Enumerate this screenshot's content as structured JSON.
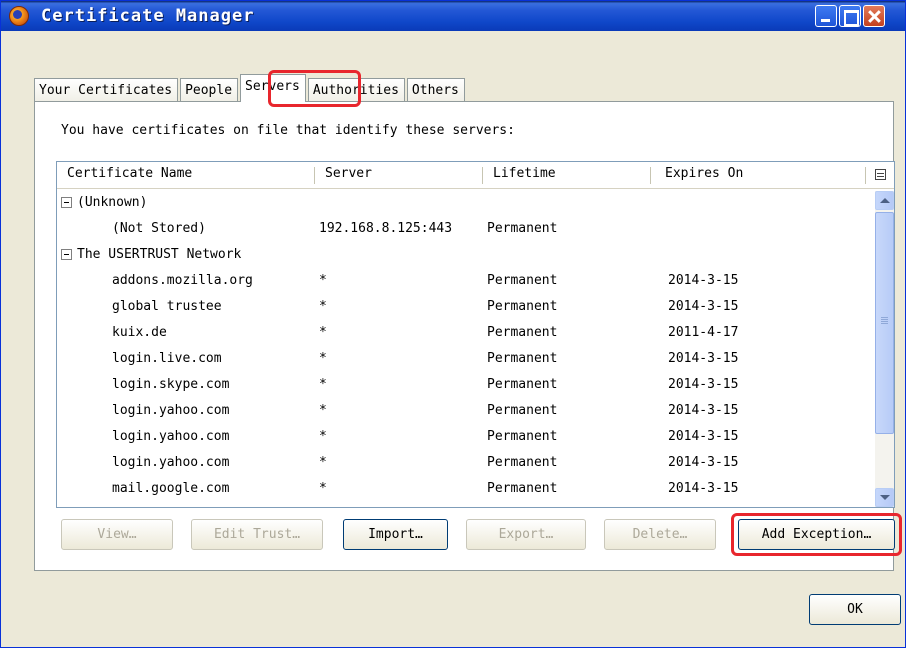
{
  "window": {
    "title": "Certificate Manager"
  },
  "tabs": [
    {
      "label": "Your Certificates"
    },
    {
      "label": "People"
    },
    {
      "label": "Servers"
    },
    {
      "label": "Authorities"
    },
    {
      "label": "Others"
    }
  ],
  "active_tab": "Servers",
  "intro_text": "You have certificates on file that identify these servers:",
  "columns": [
    "Certificate Name",
    "Server",
    "Lifetime",
    "Expires On"
  ],
  "tree": {
    "groups": [
      {
        "name": "(Unknown)",
        "rows": [
          {
            "name": "(Not Stored)",
            "server": "192.168.8.125:443",
            "lifetime": "Permanent",
            "expires": ""
          }
        ]
      },
      {
        "name": "The USERTRUST Network",
        "rows": [
          {
            "name": "addons.mozilla.org",
            "server": "*",
            "lifetime": "Permanent",
            "expires": "2014-3-15"
          },
          {
            "name": "global trustee",
            "server": "*",
            "lifetime": "Permanent",
            "expires": "2014-3-15"
          },
          {
            "name": "kuix.de",
            "server": "*",
            "lifetime": "Permanent",
            "expires": "2011-4-17"
          },
          {
            "name": "login.live.com",
            "server": "*",
            "lifetime": "Permanent",
            "expires": "2014-3-15"
          },
          {
            "name": "login.skype.com",
            "server": "*",
            "lifetime": "Permanent",
            "expires": "2014-3-15"
          },
          {
            "name": "login.yahoo.com",
            "server": "*",
            "lifetime": "Permanent",
            "expires": "2014-3-15"
          },
          {
            "name": "login.yahoo.com",
            "server": "*",
            "lifetime": "Permanent",
            "expires": "2014-3-15"
          },
          {
            "name": "login.yahoo.com",
            "server": "*",
            "lifetime": "Permanent",
            "expires": "2014-3-15"
          },
          {
            "name": "mail.google.com",
            "server": "*",
            "lifetime": "Permanent",
            "expires": "2014-3-15"
          }
        ]
      }
    ]
  },
  "buttons": {
    "view": "View…",
    "edit_trust": "Edit Trust…",
    "import": "Import…",
    "export": "Export…",
    "delete": "Delete…",
    "add_exception": "Add Exception…",
    "ok": "OK"
  },
  "icons": {
    "app": "firefox-icon",
    "minimize": "minimize-icon",
    "maximize": "maximize-icon",
    "close": "close-icon",
    "column_picker": "column-picker-icon"
  },
  "colors": {
    "highlight": "#e8262d",
    "titlebar": "#0f47c9",
    "dialog_bg": "#ece9d8"
  }
}
